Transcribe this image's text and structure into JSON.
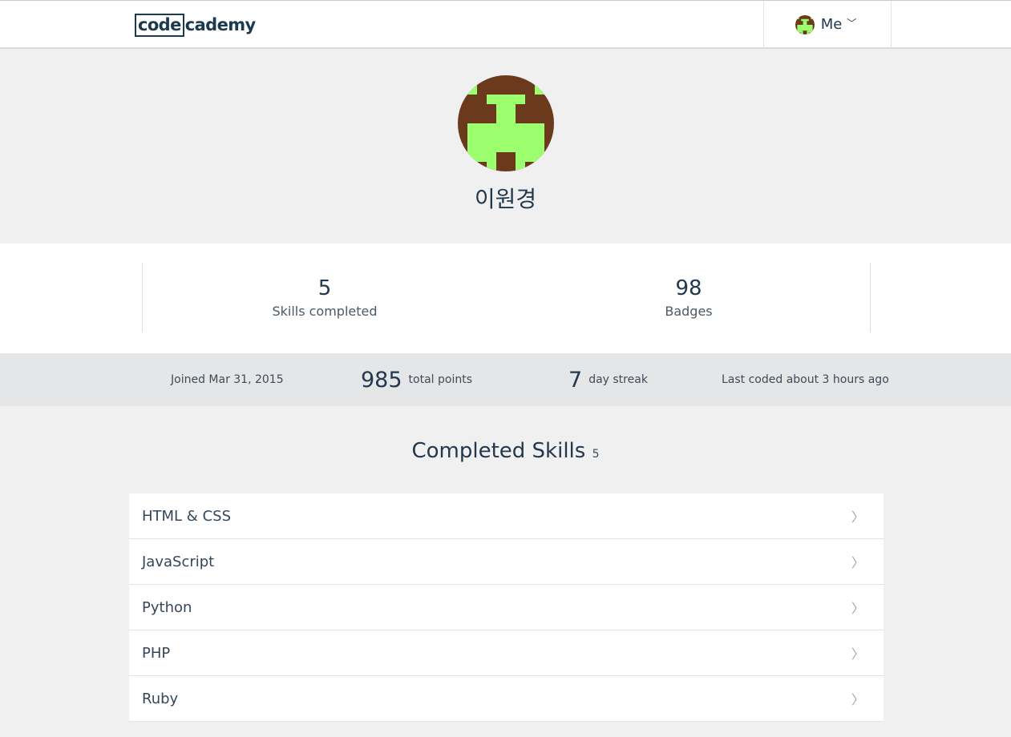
{
  "header": {
    "logo_boxed": "code",
    "logo_rest": "cademy",
    "me_label": "Me",
    "me_chevron": "﹀",
    "avatar_icon": "pixel-avatar-icon"
  },
  "profile": {
    "name": "이원경",
    "avatar_colors": {
      "background": "#6b3a1c",
      "pixels": "#9cff6e"
    }
  },
  "stats": [
    {
      "value": "5",
      "label": "Skills completed"
    },
    {
      "value": "98",
      "label": "Badges"
    }
  ],
  "info": {
    "joined": "Joined Mar 31, 2015",
    "points_value": "985",
    "points_label": "total points",
    "streak_value": "7",
    "streak_label": "day streak",
    "last_coded": "Last coded about 3 hours ago"
  },
  "completed": {
    "title": "Completed Skills",
    "count": "5",
    "chevron_icon": "chevron-right-icon",
    "items": [
      {
        "label": "HTML & CSS"
      },
      {
        "label": "JavaScript"
      },
      {
        "label": "Python"
      },
      {
        "label": "PHP"
      },
      {
        "label": "Ruby"
      }
    ]
  },
  "colors": {
    "text_primary": "#23374d",
    "page_bg": "#f0f0f0",
    "infobar_bg": "#e5e6e8"
  }
}
